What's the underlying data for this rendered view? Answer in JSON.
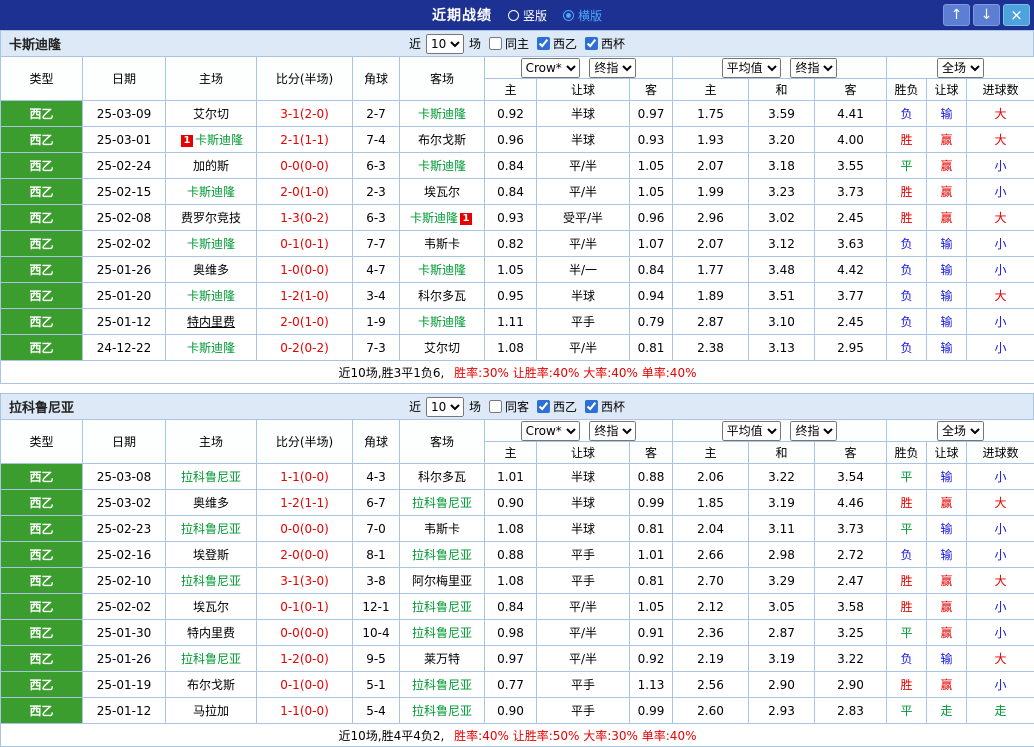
{
  "topbar": {
    "title": "近期战绩",
    "radios": [
      {
        "label": "竖版",
        "selected": false
      },
      {
        "label": "横版",
        "selected": true
      }
    ],
    "buttons": {
      "up": "↑",
      "down": "↓",
      "close": "×"
    }
  },
  "sections": [
    {
      "team": "卡斯迪隆",
      "filter": {
        "prefix": "近",
        "count": "10",
        "suffix": "场",
        "checkboxes": [
          {
            "label": "同主",
            "checked": false
          },
          {
            "label": "西乙",
            "checked": true
          },
          {
            "label": "西杯",
            "checked": true
          }
        ]
      },
      "headers": {
        "type": "类型",
        "date": "日期",
        "home": "主场",
        "score": "比分(半场)",
        "corner": "角球",
        "away": "客场",
        "odds_select1": "Crow*",
        "odds_select2": "终指",
        "avg_select1": "平均值",
        "avg_select2": "终指",
        "full_select": "全场",
        "sub": [
          "主",
          "让球",
          "客",
          "主",
          "和",
          "客",
          "胜负",
          "让球",
          "进球数"
        ]
      },
      "rows": [
        {
          "league": "西乙",
          "date": "25-03-09",
          "home": {
            "name": "艾尔切"
          },
          "score": "3-1(2-0)",
          "corner": "2-7",
          "away": {
            "name": "卡斯迪隆",
            "focus": true
          },
          "odds": [
            "0.92",
            "半球",
            "0.97"
          ],
          "avg": [
            "1.75",
            "3.59",
            "4.41"
          ],
          "results": [
            [
              "负",
              "b"
            ],
            [
              "输",
              "b"
            ],
            [
              "大",
              "r"
            ]
          ]
        },
        {
          "league": "西乙",
          "date": "25-03-01",
          "home": {
            "name": "卡斯迪隆",
            "focus": true,
            "badge_pre": "1"
          },
          "score": "2-1(1-1)",
          "corner": "7-4",
          "away": {
            "name": "布尔戈斯"
          },
          "odds": [
            "0.96",
            "半球",
            "0.93"
          ],
          "avg": [
            "1.93",
            "3.20",
            "4.00"
          ],
          "results": [
            [
              "胜",
              "r"
            ],
            [
              "赢",
              "r"
            ],
            [
              "大",
              "r"
            ]
          ]
        },
        {
          "league": "西乙",
          "date": "25-02-24",
          "home": {
            "name": "加的斯"
          },
          "score": "0-0(0-0)",
          "corner": "6-3",
          "away": {
            "name": "卡斯迪隆",
            "focus": true
          },
          "odds": [
            "0.84",
            "平/半",
            "1.05"
          ],
          "avg": [
            "2.07",
            "3.18",
            "3.55"
          ],
          "results": [
            [
              "平",
              "g"
            ],
            [
              "赢",
              "r"
            ],
            [
              "小",
              "b"
            ]
          ]
        },
        {
          "league": "西乙",
          "date": "25-02-15",
          "home": {
            "name": "卡斯迪隆",
            "focus": true
          },
          "score": "2-0(1-0)",
          "corner": "2-3",
          "away": {
            "name": "埃瓦尔"
          },
          "odds": [
            "0.84",
            "平/半",
            "1.05"
          ],
          "avg": [
            "1.99",
            "3.23",
            "3.73"
          ],
          "results": [
            [
              "胜",
              "r"
            ],
            [
              "赢",
              "r"
            ],
            [
              "小",
              "b"
            ]
          ]
        },
        {
          "league": "西乙",
          "date": "25-02-08",
          "home": {
            "name": "费罗尔竞技"
          },
          "score": "1-3(0-2)",
          "corner": "6-3",
          "away": {
            "name": "卡斯迪隆",
            "focus": true,
            "badge_post": "1"
          },
          "odds": [
            "0.93",
            "受平/半",
            "0.96"
          ],
          "avg": [
            "2.96",
            "3.02",
            "2.45"
          ],
          "results": [
            [
              "胜",
              "r"
            ],
            [
              "赢",
              "r"
            ],
            [
              "大",
              "r"
            ]
          ]
        },
        {
          "league": "西乙",
          "date": "25-02-02",
          "home": {
            "name": "卡斯迪隆",
            "focus": true
          },
          "score": "0-1(0-1)",
          "corner": "7-7",
          "away": {
            "name": "韦斯卡"
          },
          "odds": [
            "0.82",
            "平/半",
            "1.07"
          ],
          "avg": [
            "2.07",
            "3.12",
            "3.63"
          ],
          "results": [
            [
              "负",
              "b"
            ],
            [
              "输",
              "b"
            ],
            [
              "小",
              "b"
            ]
          ]
        },
        {
          "league": "西乙",
          "date": "25-01-26",
          "home": {
            "name": "奥维多"
          },
          "score": "1-0(0-0)",
          "corner": "4-7",
          "away": {
            "name": "卡斯迪隆",
            "focus": true
          },
          "odds": [
            "1.05",
            "半/一",
            "0.84"
          ],
          "avg": [
            "1.77",
            "3.48",
            "4.42"
          ],
          "results": [
            [
              "负",
              "b"
            ],
            [
              "输",
              "b"
            ],
            [
              "小",
              "b"
            ]
          ]
        },
        {
          "league": "西乙",
          "date": "25-01-20",
          "home": {
            "name": "卡斯迪隆",
            "focus": true
          },
          "score": "1-2(1-0)",
          "corner": "3-4",
          "away": {
            "name": "科尔多瓦"
          },
          "odds": [
            "0.95",
            "半球",
            "0.94"
          ],
          "avg": [
            "1.89",
            "3.51",
            "3.77"
          ],
          "results": [
            [
              "负",
              "b"
            ],
            [
              "输",
              "b"
            ],
            [
              "大",
              "r"
            ]
          ]
        },
        {
          "league": "西乙",
          "date": "25-01-12",
          "home": {
            "name": "特内里费",
            "u": true
          },
          "score": "2-0(1-0)",
          "corner": "1-9",
          "away": {
            "name": "卡斯迪隆",
            "focus": true
          },
          "odds": [
            "1.11",
            "平手",
            "0.79"
          ],
          "avg": [
            "2.87",
            "3.10",
            "2.45"
          ],
          "results": [
            [
              "负",
              "b"
            ],
            [
              "输",
              "b"
            ],
            [
              "小",
              "b"
            ]
          ]
        },
        {
          "league": "西乙",
          "date": "24-12-22",
          "home": {
            "name": "卡斯迪隆",
            "focus": true
          },
          "score": "0-2(0-2)",
          "corner": "7-3",
          "away": {
            "name": "艾尔切"
          },
          "odds": [
            "1.08",
            "平/半",
            "0.81"
          ],
          "avg": [
            "2.38",
            "3.13",
            "2.95"
          ],
          "results": [
            [
              "负",
              "b"
            ],
            [
              "输",
              "b"
            ],
            [
              "小",
              "b"
            ]
          ]
        }
      ],
      "summary": {
        "prefix": "近10场,胜3平1负6,",
        "rates": "胜率:30% 让胜率:40% 大率:40% 单率:40%"
      }
    },
    {
      "team": "拉科鲁尼亚",
      "filter": {
        "prefix": "近",
        "count": "10",
        "suffix": "场",
        "checkboxes": [
          {
            "label": "同客",
            "checked": false
          },
          {
            "label": "西乙",
            "checked": true
          },
          {
            "label": "西杯",
            "checked": true
          }
        ]
      },
      "headers": {
        "type": "类型",
        "date": "日期",
        "home": "主场",
        "score": "比分(半场)",
        "corner": "角球",
        "away": "客场",
        "odds_select1": "Crow*",
        "odds_select2": "终指",
        "avg_select1": "平均值",
        "avg_select2": "终指",
        "full_select": "全场",
        "sub": [
          "主",
          "让球",
          "客",
          "主",
          "和",
          "客",
          "胜负",
          "让球",
          "进球数"
        ]
      },
      "rows": [
        {
          "league": "西乙",
          "date": "25-03-08",
          "home": {
            "name": "拉科鲁尼亚",
            "focus": true
          },
          "score": "1-1(0-0)",
          "corner": "4-3",
          "away": {
            "name": "科尔多瓦"
          },
          "odds": [
            "1.01",
            "半球",
            "0.88"
          ],
          "avg": [
            "2.06",
            "3.22",
            "3.54"
          ],
          "results": [
            [
              "平",
              "g"
            ],
            [
              "输",
              "b"
            ],
            [
              "小",
              "b"
            ]
          ]
        },
        {
          "league": "西乙",
          "date": "25-03-02",
          "home": {
            "name": "奥维多"
          },
          "score": "1-2(1-1)",
          "corner": "6-7",
          "away": {
            "name": "拉科鲁尼亚",
            "focus": true
          },
          "odds": [
            "0.90",
            "半球",
            "0.99"
          ],
          "avg": [
            "1.85",
            "3.19",
            "4.46"
          ],
          "results": [
            [
              "胜",
              "r"
            ],
            [
              "赢",
              "r"
            ],
            [
              "大",
              "r"
            ]
          ]
        },
        {
          "league": "西乙",
          "date": "25-02-23",
          "home": {
            "name": "拉科鲁尼亚",
            "focus": true
          },
          "score": "0-0(0-0)",
          "corner": "7-0",
          "away": {
            "name": "韦斯卡"
          },
          "odds": [
            "1.08",
            "半球",
            "0.81"
          ],
          "avg": [
            "2.04",
            "3.11",
            "3.73"
          ],
          "results": [
            [
              "平",
              "g"
            ],
            [
              "输",
              "b"
            ],
            [
              "小",
              "b"
            ]
          ]
        },
        {
          "league": "西乙",
          "date": "25-02-16",
          "home": {
            "name": "埃登斯"
          },
          "score": "2-0(0-0)",
          "corner": "8-1",
          "away": {
            "name": "拉科鲁尼亚",
            "focus": true
          },
          "odds": [
            "0.88",
            "平手",
            "1.01"
          ],
          "avg": [
            "2.66",
            "2.98",
            "2.72"
          ],
          "results": [
            [
              "负",
              "b"
            ],
            [
              "输",
              "b"
            ],
            [
              "小",
              "b"
            ]
          ]
        },
        {
          "league": "西乙",
          "date": "25-02-10",
          "home": {
            "name": "拉科鲁尼亚",
            "focus": true
          },
          "score": "3-1(3-0)",
          "corner": "3-8",
          "away": {
            "name": "阿尔梅里亚"
          },
          "odds": [
            "1.08",
            "平手",
            "0.81"
          ],
          "avg": [
            "2.70",
            "3.29",
            "2.47"
          ],
          "results": [
            [
              "胜",
              "r"
            ],
            [
              "赢",
              "r"
            ],
            [
              "大",
              "r"
            ]
          ]
        },
        {
          "league": "西乙",
          "date": "25-02-02",
          "home": {
            "name": "埃瓦尔"
          },
          "score": "0-1(0-1)",
          "corner": "12-1",
          "away": {
            "name": "拉科鲁尼亚",
            "focus": true
          },
          "odds": [
            "0.84",
            "平/半",
            "1.05"
          ],
          "avg": [
            "2.12",
            "3.05",
            "3.58"
          ],
          "results": [
            [
              "胜",
              "r"
            ],
            [
              "赢",
              "r"
            ],
            [
              "小",
              "b"
            ]
          ]
        },
        {
          "league": "西乙",
          "date": "25-01-30",
          "home": {
            "name": "特内里费"
          },
          "score": "0-0(0-0)",
          "corner": "10-4",
          "away": {
            "name": "拉科鲁尼亚",
            "focus": true
          },
          "odds": [
            "0.98",
            "平/半",
            "0.91"
          ],
          "avg": [
            "2.36",
            "2.87",
            "3.25"
          ],
          "results": [
            [
              "平",
              "g"
            ],
            [
              "赢",
              "r"
            ],
            [
              "小",
              "b"
            ]
          ]
        },
        {
          "league": "西乙",
          "date": "25-01-26",
          "home": {
            "name": "拉科鲁尼亚",
            "focus": true
          },
          "score": "1-2(0-0)",
          "corner": "9-5",
          "away": {
            "name": "莱万特"
          },
          "odds": [
            "0.97",
            "平/半",
            "0.92"
          ],
          "avg": [
            "2.19",
            "3.19",
            "3.22"
          ],
          "results": [
            [
              "负",
              "b"
            ],
            [
              "输",
              "b"
            ],
            [
              "大",
              "r"
            ]
          ]
        },
        {
          "league": "西乙",
          "date": "25-01-19",
          "home": {
            "name": "布尔戈斯"
          },
          "score": "0-1(0-0)",
          "corner": "5-1",
          "away": {
            "name": "拉科鲁尼亚",
            "focus": true
          },
          "odds": [
            "0.77",
            "平手",
            "1.13"
          ],
          "avg": [
            "2.56",
            "2.90",
            "2.90"
          ],
          "results": [
            [
              "胜",
              "r"
            ],
            [
              "赢",
              "r"
            ],
            [
              "小",
              "b"
            ]
          ]
        },
        {
          "league": "西乙",
          "date": "25-01-12",
          "home": {
            "name": "马拉加"
          },
          "score": "1-1(0-0)",
          "corner": "5-4",
          "away": {
            "name": "拉科鲁尼亚",
            "focus": true
          },
          "odds": [
            "0.90",
            "平手",
            "0.99"
          ],
          "avg": [
            "2.60",
            "2.93",
            "2.83"
          ],
          "results": [
            [
              "平",
              "g"
            ],
            [
              "走",
              "g"
            ],
            [
              "走",
              "g"
            ]
          ]
        }
      ],
      "summary": {
        "prefix": "近10场,胜4平4负2,",
        "rates": "胜率:40% 让胜率:50% 大率:30% 单率:40%"
      }
    }
  ]
}
